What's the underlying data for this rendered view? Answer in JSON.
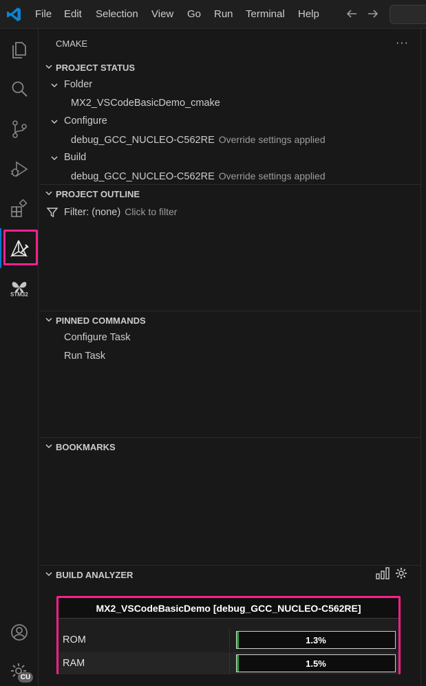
{
  "menu": [
    "File",
    "Edit",
    "Selection",
    "View",
    "Go",
    "Run",
    "Terminal",
    "Help"
  ],
  "activity_bar": {
    "stm32_label": "STM32",
    "account_badge": "CU"
  },
  "sidebar": {
    "title": "CMAKE",
    "more": "···",
    "project_status": {
      "header": "PROJECT STATUS",
      "folder_label": "Folder",
      "folder_value": "MX2_VSCodeBasicDemo_cmake",
      "configure_label": "Configure",
      "configure_value": "debug_GCC_NUCLEO-C562RE",
      "configure_desc": "Override settings applied",
      "build_label": "Build",
      "build_value": "debug_GCC_NUCLEO-C562RE",
      "build_desc": "Override settings applied"
    },
    "project_outline": {
      "header": "PROJECT OUTLINE",
      "filter_label": "Filter: (none)",
      "filter_hint": "Click to filter"
    },
    "pinned_commands": {
      "header": "PINNED COMMANDS",
      "items": [
        "Configure Task",
        "Run Task"
      ]
    },
    "bookmarks": {
      "header": "BOOKMARKS"
    },
    "build_analyzer": {
      "header": "BUILD ANALYZER",
      "title": "MX2_VSCodeBasicDemo [debug_GCC_NUCLEO-C562RE]",
      "rows": [
        {
          "name": "ROM",
          "percent_text": "1.3%",
          "percent": 1.3
        },
        {
          "name": "RAM",
          "percent_text": "1.5%",
          "percent": 1.5
        }
      ]
    }
  }
}
